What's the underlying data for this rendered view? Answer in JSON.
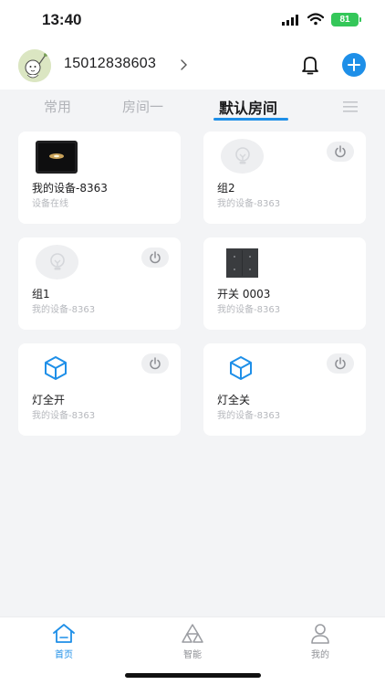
{
  "status_bar": {
    "time": "13:40",
    "battery": "81"
  },
  "header": {
    "account": "15012838603"
  },
  "tabs": [
    {
      "label": "常用"
    },
    {
      "label": "房间一"
    },
    {
      "label": "默认房间"
    }
  ],
  "devices": [
    {
      "name": "我的设备-8363",
      "sub": "设备在线",
      "icon": "device-photo"
    },
    {
      "name": "组2",
      "sub": "我的设备-8363",
      "icon": "bulb-icon"
    },
    {
      "name": "组1",
      "sub": "我的设备-8363",
      "icon": "bulb-icon"
    },
    {
      "name": "开关 0003",
      "sub": "我的设备-8363",
      "icon": "switch-panel-photo"
    },
    {
      "name": "灯全开",
      "sub": "我的设备-8363",
      "icon": "cube-icon"
    },
    {
      "name": "灯全关",
      "sub": "我的设备-8363",
      "icon": "cube-icon"
    }
  ],
  "bottom_nav": [
    {
      "label": "首页",
      "icon": "home-icon",
      "active": true
    },
    {
      "label": "智能",
      "icon": "smart-icon",
      "active": false
    },
    {
      "label": "我的",
      "icon": "profile-icon",
      "active": false
    }
  ],
  "colors": {
    "accent": "#1e8fe8",
    "background": "#f3f4f6",
    "battery": "#34c759"
  }
}
